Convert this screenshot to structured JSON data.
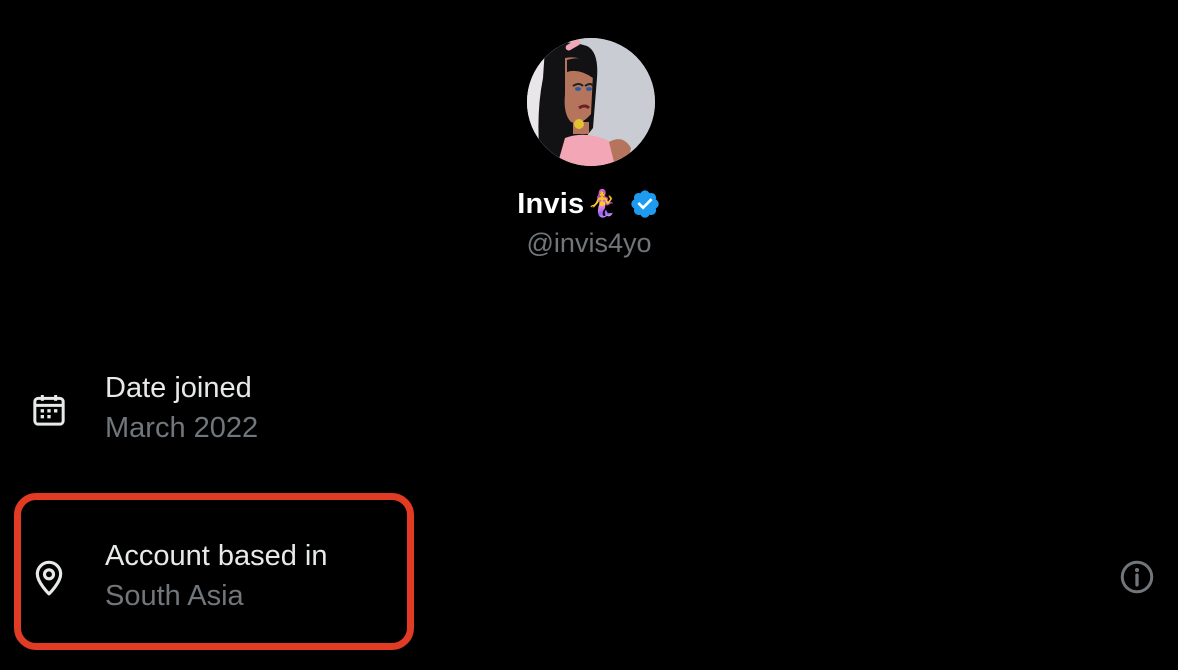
{
  "profile": {
    "display_name": "Invis",
    "name_emoji": "🧜‍♀️",
    "verified": true,
    "handle": "@invis4yo",
    "avatar_icon": "cartoon-girl-avatar"
  },
  "details": {
    "joined": {
      "label": "Date joined",
      "value": "March 2022",
      "icon": "calendar-icon"
    },
    "location": {
      "label": "Account based in",
      "value": "South Asia",
      "icon": "location-pin-icon",
      "info_icon": "info-icon"
    }
  },
  "colors": {
    "background": "#000000",
    "primary_text": "#e7e9ea",
    "secondary_text": "#71767b",
    "verified_badge": "#1d9bf0",
    "highlight": "#e23b25"
  }
}
